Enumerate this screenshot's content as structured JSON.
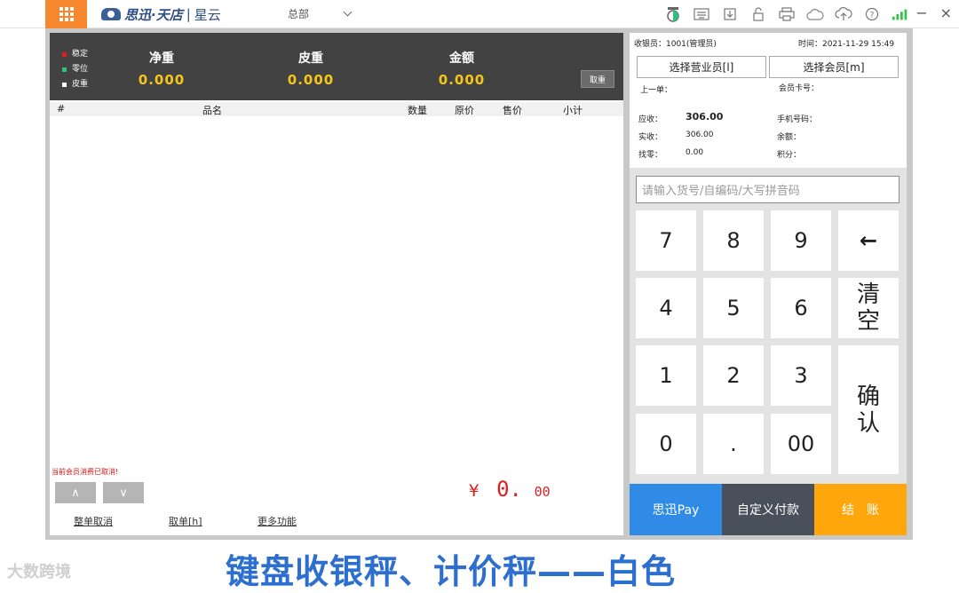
{
  "app": {
    "logo_text": "思迅·天店",
    "logo_sub": "星云",
    "store": "总部"
  },
  "top_icons": [
    "scale-icon",
    "keyboard-icon",
    "download-icon",
    "lock-icon",
    "printer-icon",
    "cloud-icon",
    "cloud-upload-icon",
    "help-icon",
    "signal-icon"
  ],
  "window": {
    "minimize": "−",
    "close": "×"
  },
  "scale": {
    "status": [
      {
        "label": "稳定",
        "color": "#e02020"
      },
      {
        "label": "零位",
        "color": "#2ec27e"
      },
      {
        "label": "皮重",
        "color": "#ffffff"
      }
    ],
    "net_label": "净重",
    "net_value": "0.000",
    "tare_label": "皮重",
    "tare_value": "0.000",
    "amount_label": "金额",
    "amount_value": "0.000",
    "tare_button": "取重"
  },
  "table": {
    "columns": [
      "#",
      "品名",
      "数量",
      "原价",
      "售价",
      "小计"
    ],
    "rows": []
  },
  "notice": "当前会员消费已取消!",
  "nav": {
    "up": "∧",
    "down": "∨"
  },
  "total": {
    "symbol": "¥",
    "integer": "0.",
    "decimal": "00"
  },
  "actions": {
    "cancel_order": "整单取消",
    "take_order": "取单[h]",
    "more": "更多功能"
  },
  "info": {
    "cashier": "收银员：1001(管理员)",
    "time": "时间：2021-11-29 15:49",
    "select_salesperson": "选择营业员[l]",
    "select_member": "选择会员[m]",
    "last_order": "上一单：",
    "member_card": "会员卡号：",
    "due_label": "应收：",
    "due_value": "306.00",
    "paid_label": "实收：",
    "paid_value": "306.00",
    "change_label": "找零：",
    "change_value": "0.00",
    "phone": "手机号码：",
    "balance": "余额：",
    "points": "积分："
  },
  "search": {
    "placeholder": "请输入货号/自编码/大写拼音码"
  },
  "keypad": {
    "k7": "7",
    "k8": "8",
    "k9": "9",
    "back": "←",
    "k4": "4",
    "k5": "5",
    "k6": "6",
    "clear": "清空",
    "k1": "1",
    "k2": "2",
    "k3": "3",
    "confirm": "确认",
    "k0": "0",
    "dot": ".",
    "k00": "00"
  },
  "payment": {
    "pay": "思迅Pay",
    "pay_color": "#2f8be6",
    "custom": "自定义付款",
    "custom_color": "#4a4f5c",
    "checkout": "结　账",
    "checkout_color": "#ffa60d"
  },
  "watermark": "大数跨境",
  "caption": "键盘收银秤、计价秤——白色"
}
